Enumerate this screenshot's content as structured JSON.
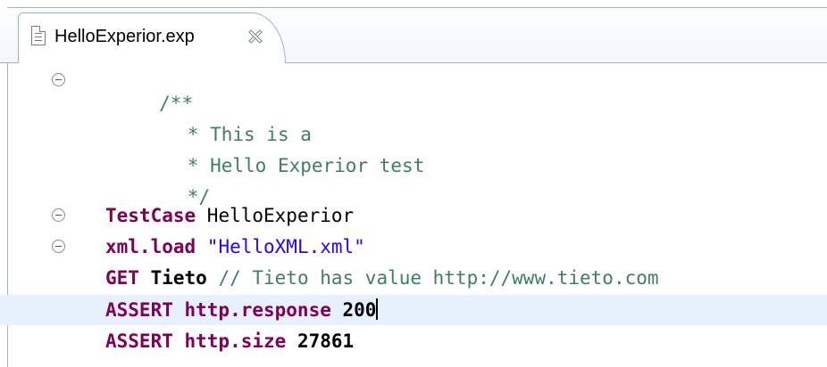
{
  "tab": {
    "icon": "file-icon",
    "title": "HelloExperior.exp",
    "close_icon": "close-icon"
  },
  "code": {
    "comment_open": "/**",
    "comment_line1": " * This is a",
    "comment_line2": " * Hello Experior test",
    "comment_close": " */",
    "testcase_keyword": "TestCase",
    "testcase_name": " HelloExperior",
    "xmlload_keyword": "xml.load",
    "xmlload_string": " \"HelloXML.xml\"",
    "get_keyword": "GET",
    "get_target": " Tieto",
    "get_comment": " // Tieto has value http://www.tieto.com",
    "assert1_keyword": "ASSERT",
    "assert1_target": " http.response",
    "assert1_value": " 200",
    "assert2_keyword": "ASSERT",
    "assert2_target": " http.size",
    "assert2_value": " 27861"
  },
  "colors": {
    "keyword": "#7f0055",
    "comment": "#3f7f5f",
    "string": "#2a00ff",
    "current_line": "#e8f2fe"
  }
}
